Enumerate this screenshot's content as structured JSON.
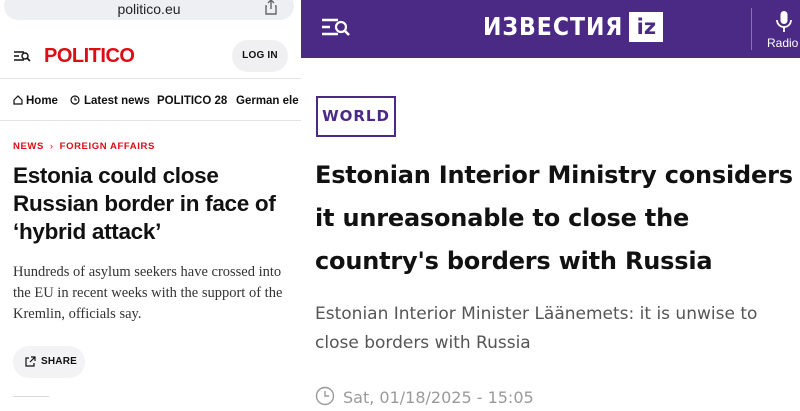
{
  "browser": {
    "url": "politico.eu"
  },
  "politico": {
    "logo": "POLITICO",
    "login_label": "LOG IN",
    "nav": [
      "Home",
      "Latest news",
      "POLITICO 28",
      "German ele"
    ],
    "breadcrumb": [
      "NEWS",
      "FOREIGN AFFAIRS"
    ],
    "headline": "Estonia could close Russian border in face of ‘hybrid attack’",
    "dek": "Hundreds of asylum seekers have crossed into the EU in recent weeks with the support of the Kremlin, officials say.",
    "share_label": "SHARE",
    "brand_color": "#dc0d15",
    "icons": [
      "menu-search-icon",
      "share-icon",
      "home-icon",
      "clock-icon"
    ]
  },
  "izvestia": {
    "logo_text": "ИЗВЕСТИЯ",
    "logo_badge": "iz",
    "radio_label": "Radio",
    "section": "WORLD",
    "headline": "Estonian Interior Ministry considers it unreasonable to close the country's borders with Russia",
    "dek": "Estonian Interior Minister Läänemets: it is unwise to close borders with Russia",
    "date": "Sat, 01/18/2025 - 15:05",
    "brand_color": "#4b2a86",
    "icons": [
      "menu-search-icon",
      "microphone-icon",
      "clock-icon"
    ]
  }
}
